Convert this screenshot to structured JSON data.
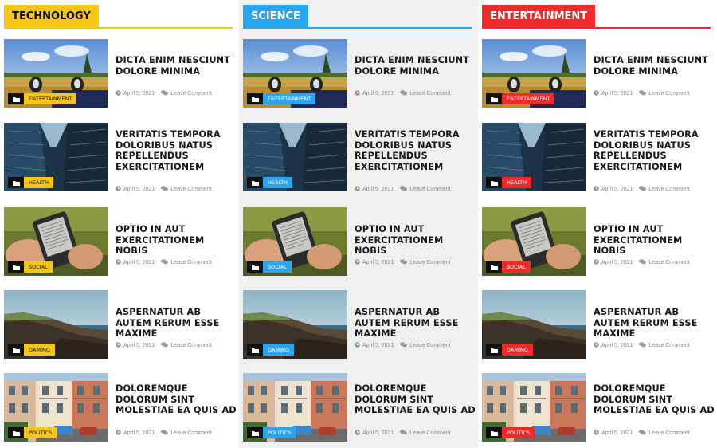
{
  "columns": [
    {
      "title": "TECHNOLOGY",
      "accent": "#f5c518",
      "label_color": "#111111",
      "posts": [
        {
          "title": "DICTA ENIM NESCIUNT DOLORE MINIMA",
          "category": "ENTERTAINMENT",
          "date": "April 5, 2021",
          "comment": "Leave Comment",
          "image": "field"
        },
        {
          "title": "VERITATIS TEMPORA DOLORIBUS NATUS REPELLENDUS EXERCITATIONEM",
          "category": "HEALTH",
          "date": "April 5, 2021",
          "comment": "Leave Comment",
          "image": "building"
        },
        {
          "title": "OPTIO IN AUT EXERCITATIONEM NOBIS",
          "category": "SOCIAL",
          "date": "April 5, 2021",
          "comment": "Leave Comment",
          "image": "ereader"
        },
        {
          "title": "ASPERNATUR AB AUTEM RERUM ESSE MAXIME",
          "category": "GAMING",
          "date": "April 5, 2021",
          "comment": "Leave Comment",
          "image": "coast"
        },
        {
          "title": "DOLOREMQUE DOLORUM SINT MOLESTIAE EA QUIS AD",
          "category": "POLITICS",
          "date": "April 5, 2021",
          "comment": "Leave Comment",
          "image": "street"
        }
      ]
    },
    {
      "title": "SCIENCE",
      "accent": "#2aa6f0",
      "label_color": "#ffffff",
      "posts": [
        {
          "title": "DICTA ENIM NESCIUNT DOLORE MINIMA",
          "category": "ENTERTAINMENT",
          "date": "April 5, 2021",
          "comment": "Leave Comment",
          "image": "field"
        },
        {
          "title": "VERITATIS TEMPORA DOLORIBUS NATUS REPELLENDUS EXERCITATIONEM",
          "category": "HEALTH",
          "date": "April 5, 2021",
          "comment": "Leave Comment",
          "image": "building"
        },
        {
          "title": "OPTIO IN AUT EXERCITATIONEM NOBIS",
          "category": "SOCIAL",
          "date": "April 5, 2021",
          "comment": "Leave Comment",
          "image": "ereader"
        },
        {
          "title": "ASPERNATUR AB AUTEM RERUM ESSE MAXIME",
          "category": "GAMING",
          "date": "April 5, 2021",
          "comment": "Leave Comment",
          "image": "coast"
        },
        {
          "title": "DOLOREMQUE DOLORUM SINT MOLESTIAE EA QUIS AD",
          "category": "POLITICS",
          "date": "April 5, 2021",
          "comment": "Leave Comment",
          "image": "street"
        }
      ]
    },
    {
      "title": "ENTERTAINMENT",
      "accent": "#ee2a2a",
      "label_color": "#ffffff",
      "posts": [
        {
          "title": "DICTA ENIM NESCIUNT DOLORE MINIMA",
          "category": "ENTERTAINMENT",
          "date": "April 5, 2021",
          "comment": "Leave Comment",
          "image": "field"
        },
        {
          "title": "VERITATIS TEMPORA DOLORIBUS NATUS REPELLENDUS EXERCITATIONEM",
          "category": "HEALTH",
          "date": "April 5, 2021",
          "comment": "Leave Comment",
          "image": "building"
        },
        {
          "title": "OPTIO IN AUT EXERCITATIONEM NOBIS",
          "category": "SOCIAL",
          "date": "April 5, 2021",
          "comment": "Leave Comment",
          "image": "ereader"
        },
        {
          "title": "ASPERNATUR AB AUTEM RERUM ESSE MAXIME",
          "category": "GAMING",
          "date": "April 5, 2021",
          "comment": "Leave Comment",
          "image": "coast"
        },
        {
          "title": "DOLOREMQUE DOLORUM SINT MOLESTIAE EA QUIS AD",
          "category": "POLITICS",
          "date": "April 5, 2021",
          "comment": "Leave Comment",
          "image": "street"
        }
      ]
    }
  ]
}
